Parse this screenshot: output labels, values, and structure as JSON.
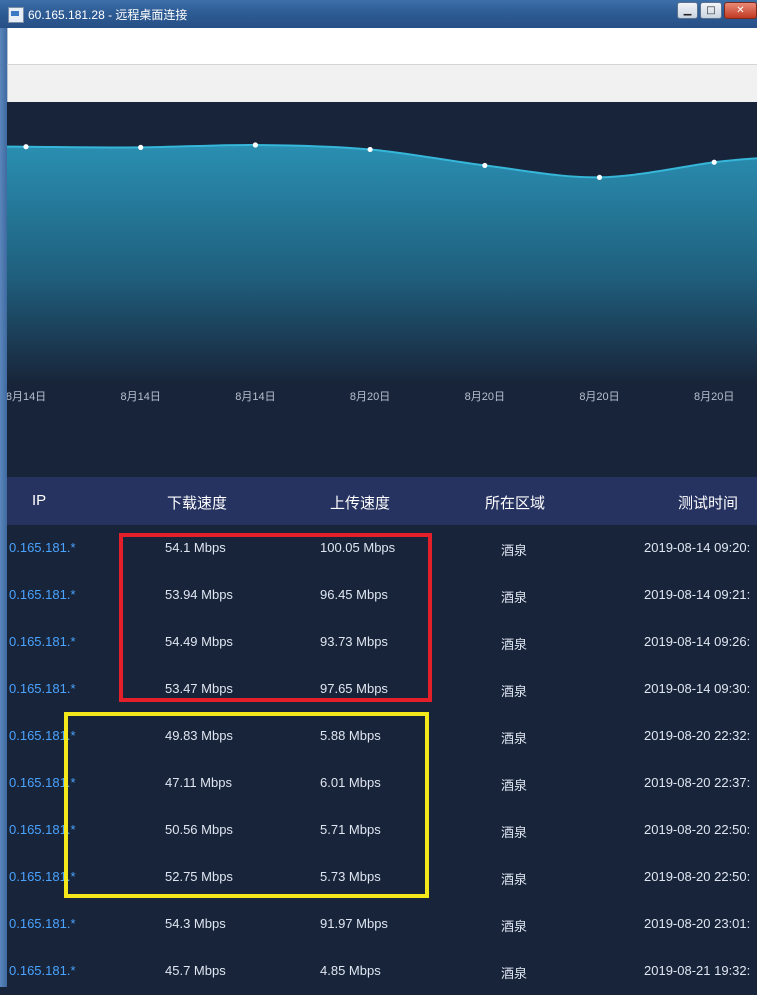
{
  "window": {
    "title": "60.165.181.28 - 远程桌面连接",
    "controls": {
      "minimize": "▁",
      "maximize": "□",
      "close": "✕"
    }
  },
  "chart_data": {
    "type": "area",
    "categories": [
      "8月14日",
      "8月14日",
      "8月14日",
      "8月20日",
      "8月20日",
      "8月20日",
      "8月20日"
    ],
    "x_tick_labels": [
      "8月14日",
      "8月14日",
      "8月14日",
      "8月20日",
      "8月20日",
      "8月20日",
      "8月20日"
    ],
    "series": [
      {
        "values": [
          54.1,
          53.94,
          54.49,
          53.47,
          49.83,
          47.11,
          50.56
        ]
      }
    ],
    "ylim": [
      0,
      60
    ],
    "grid": false,
    "colors": {
      "line": "#36b6d8",
      "fill_top": "#2a8fb2",
      "fill_bottom": "#182438",
      "point": "#ffffff"
    }
  },
  "table": {
    "headers": {
      "ip": "IP",
      "download": "下载速度",
      "upload": "上传速度",
      "region": "所在区域",
      "time": "测试时间"
    },
    "rows": [
      {
        "ip": "0.165.181.*",
        "download": "54.1 Mbps",
        "upload": "100.05 Mbps",
        "region": "酒泉",
        "time": "2019-08-14 09:20:"
      },
      {
        "ip": "0.165.181.*",
        "download": "53.94 Mbps",
        "upload": "96.45 Mbps",
        "region": "酒泉",
        "time": "2019-08-14 09:21:"
      },
      {
        "ip": "0.165.181.*",
        "download": "54.49 Mbps",
        "upload": "93.73 Mbps",
        "region": "酒泉",
        "time": "2019-08-14 09:26:"
      },
      {
        "ip": "0.165.181.*",
        "download": "53.47 Mbps",
        "upload": "97.65 Mbps",
        "region": "酒泉",
        "time": "2019-08-14 09:30:"
      },
      {
        "ip": "0.165.181.*",
        "download": "49.83 Mbps",
        "upload": "5.88 Mbps",
        "region": "酒泉",
        "time": "2019-08-20 22:32:"
      },
      {
        "ip": "0.165.181.*",
        "download": "47.11 Mbps",
        "upload": "6.01 Mbps",
        "region": "酒泉",
        "time": "2019-08-20 22:37:"
      },
      {
        "ip": "0.165.181.*",
        "download": "50.56 Mbps",
        "upload": "5.71 Mbps",
        "region": "酒泉",
        "time": "2019-08-20 22:50:"
      },
      {
        "ip": "0.165.181.*",
        "download": "52.75 Mbps",
        "upload": "5.73 Mbps",
        "region": "酒泉",
        "time": "2019-08-20 22:50:"
      },
      {
        "ip": "0.165.181.*",
        "download": "54.3 Mbps",
        "upload": "91.97 Mbps",
        "region": "酒泉",
        "time": "2019-08-20 23:01:"
      },
      {
        "ip": "0.165.181.*",
        "download": "45.7 Mbps",
        "upload": "4.85 Mbps",
        "region": "酒泉",
        "time": "2019-08-21 19:32:"
      }
    ]
  },
  "highlights": {
    "red": "#e3202a",
    "yellow": "#f4e81a"
  }
}
